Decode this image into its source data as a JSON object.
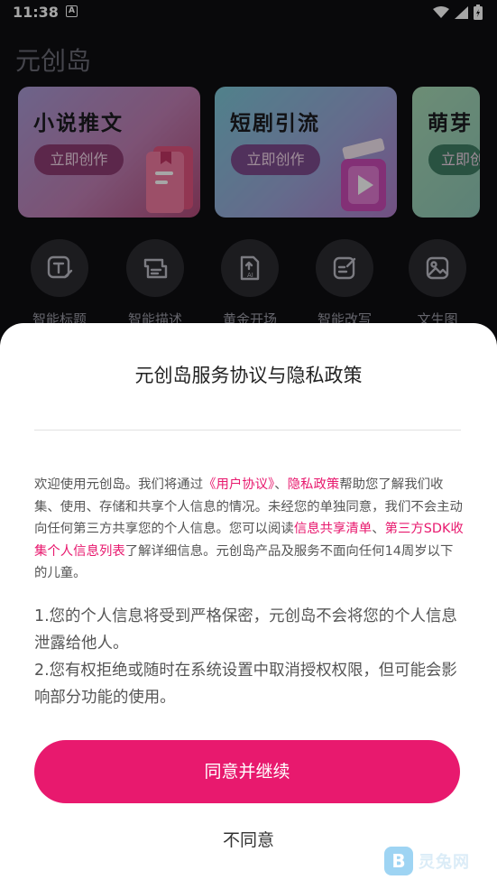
{
  "status_bar": {
    "time": "11:38",
    "notification_letter": "A",
    "icons": [
      "wifi-icon",
      "signal-icon",
      "battery-icon"
    ]
  },
  "app": {
    "title": "元创岛"
  },
  "cards": [
    {
      "title": "小说推文",
      "button": "立即创作",
      "icon": "book-icon"
    },
    {
      "title": "短剧引流",
      "button": "立即创作",
      "icon": "clapperboard-icon"
    },
    {
      "title": "萌芽",
      "button": "立即创作",
      "icon": "sprout-icon"
    }
  ],
  "tools": [
    {
      "label": "智能标题",
      "icon": "title-edit-icon"
    },
    {
      "label": "智能描述",
      "icon": "description-icon"
    },
    {
      "label": "黄金开场",
      "icon": "ai-document-icon"
    },
    {
      "label": "智能改写",
      "icon": "rewrite-icon"
    },
    {
      "label": "文生图",
      "icon": "image-icon"
    }
  ],
  "dialog": {
    "title": "元创岛服务协议与隐私政策",
    "body_parts": {
      "p1": "欢迎使用元创岛。我们将通过",
      "link_user_agreement": "《用户协议》",
      "p2": "、",
      "link_privacy": "隐私政策",
      "p3": "帮助您了解我们收集、使用、存储和共享个人信息的情况。未经您的单独同意，我们不会主动向任何第三方共享您的个人信息。您可以阅读",
      "link_info_share": "信息共享清单",
      "p4": "、",
      "link_sdk": "第三方SDK收集个人信息列表",
      "p5": "了解详细信息。元创岛产品及服务不面向任何14周岁以下的儿童。"
    },
    "points": [
      "1.您的个人信息将受到严格保密，元创岛不会将您的个人信息泄露给他人。",
      "2.您有权拒绝或随时在系统设置中取消授权权限，但可能会影响部分功能的使用。"
    ],
    "agree_button": "同意并继续",
    "disagree_button": "不同意"
  },
  "watermark": {
    "logo_letter": "B",
    "text": "灵兔网"
  },
  "colors": {
    "accent": "#e8196e",
    "background": "#0e0e12",
    "sheet": "#ffffff"
  }
}
